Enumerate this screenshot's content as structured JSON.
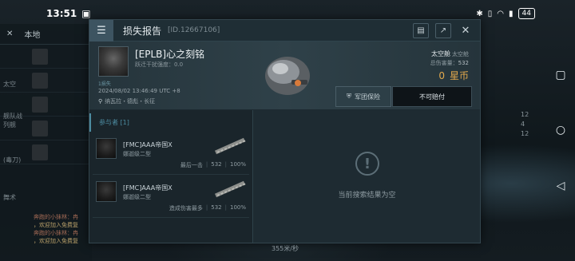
{
  "status": {
    "time": "13:51",
    "battery": "44"
  },
  "left_panel": {
    "tab_label": "本地",
    "side_labels": [
      "太空",
      "舰队战列舰",
      "(毒刀)",
      "舞术"
    ],
    "chat": [
      "奔跑的小抹林：冉",
      "，欢迎加入免费复",
      "奔跑的小抹林：冉",
      "，欢迎加入免费复"
    ]
  },
  "right_stats": [
    "12",
    "4",
    "12"
  ],
  "modal": {
    "title": "损失报告",
    "report_id": "[ID.12667106]",
    "pilot": {
      "name": "[EPLB]心之刻铭",
      "sub": "跃迁干扰强度：0.0",
      "tag": "1损失",
      "time": "2024/08/02 13:46:49 UTC +8",
      "location": "纳瓦拉・德彪・长征"
    },
    "ship_type": "太空舱",
    "ship_class": "太空舱",
    "damage_label": "总伤害量：",
    "damage_value": "532",
    "value_amount": "0",
    "value_unit": "星币",
    "insure_label": "军团保险",
    "pay_label": "不可赔付",
    "participants_label": "参与者 [1]",
    "participants": [
      {
        "name": "[FMC]AAA帝国X",
        "ship": "娜迦级二型",
        "tag": "最后一击",
        "damage": "532",
        "percent": "100%"
      },
      {
        "name": "[FMC]AAA帝国X",
        "ship": "娜迦级二型",
        "tag": "造成伤害最多",
        "damage": "532",
        "percent": "100%"
      }
    ],
    "empty_text": "当前搜索结果为空"
  },
  "bottom_speed": "355米/秒"
}
